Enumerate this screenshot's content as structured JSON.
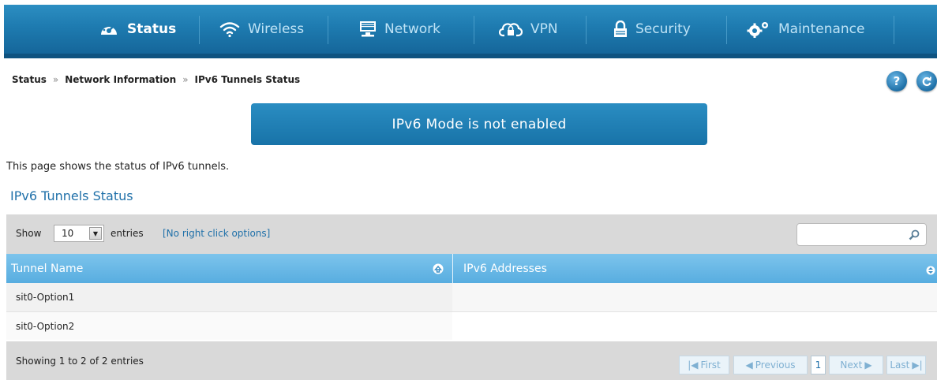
{
  "nav": {
    "items": [
      {
        "label": "Status",
        "icon": "gauge-icon",
        "active": true
      },
      {
        "label": "Wireless",
        "icon": "wifi-icon",
        "active": false
      },
      {
        "label": "Network",
        "icon": "monitor-icon",
        "active": false
      },
      {
        "label": "VPN",
        "icon": "cloud-lock-icon",
        "active": false
      },
      {
        "label": "Security",
        "icon": "lock-icon",
        "active": false
      },
      {
        "label": "Maintenance",
        "icon": "gears-icon",
        "active": false
      }
    ]
  },
  "breadcrumb": {
    "items": [
      "Status",
      "Network Information",
      "IPv6 Tunnels Status"
    ],
    "separator": "»"
  },
  "help_icon_label": "?",
  "alert": {
    "text": "IPv6 Mode is not enabled"
  },
  "description": "This page shows the status of IPv6 tunnels.",
  "section_title": "IPv6 Tunnels Status",
  "table": {
    "show_label": "Show",
    "page_size": "10",
    "entries_label": "entries",
    "options_link": "[No right click options]",
    "search_value": "",
    "columns": [
      "Tunnel Name",
      "IPv6 Addresses"
    ],
    "rows": [
      {
        "tunnel_name": "sit0-Option1",
        "ipv6_addresses": ""
      },
      {
        "tunnel_name": "sit0-Option2",
        "ipv6_addresses": ""
      }
    ],
    "footer_text": "Showing 1 to 2 of 2 entries",
    "pagination": {
      "first": "First",
      "previous": "Previous",
      "current": "1",
      "next": "Next",
      "last": "Last"
    }
  },
  "colors": {
    "nav_blue": "#1e7bb0",
    "header_blue": "#58ade0",
    "accent": "#1f70a9"
  }
}
